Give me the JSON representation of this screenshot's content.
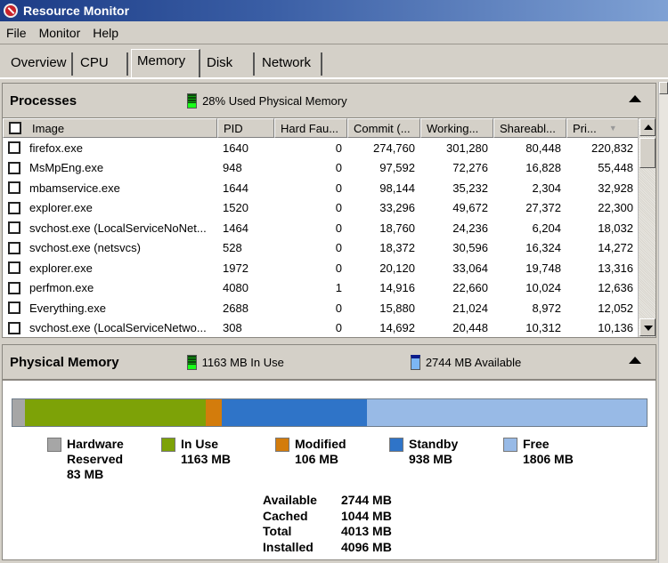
{
  "window": {
    "title": "Resource Monitor",
    "icon": "resource-monitor-icon"
  },
  "menu": [
    "File",
    "Monitor",
    "Help"
  ],
  "tabs": [
    {
      "label": "Overview",
      "active": false
    },
    {
      "label": "CPU",
      "active": false
    },
    {
      "label": "Memory",
      "active": true
    },
    {
      "label": "Disk",
      "active": false
    },
    {
      "label": "Network",
      "active": false
    }
  ],
  "processes": {
    "title": "Processes",
    "status": "28% Used Physical Memory",
    "columns": [
      "Image",
      "PID",
      "Hard Fau...",
      "Commit (...",
      "Working...",
      "Shareabl...",
      "Pri..."
    ],
    "sort_column": "Pri...",
    "rows": [
      {
        "image": "firefox.exe",
        "pid": "1640",
        "hard_faults": "0",
        "commit": "274,760",
        "working": "301,280",
        "shareable": "80,448",
        "private": "220,832"
      },
      {
        "image": "MsMpEng.exe",
        "pid": "948",
        "hard_faults": "0",
        "commit": "97,592",
        "working": "72,276",
        "shareable": "16,828",
        "private": "55,448"
      },
      {
        "image": "mbamservice.exe",
        "pid": "1644",
        "hard_faults": "0",
        "commit": "98,144",
        "working": "35,232",
        "shareable": "2,304",
        "private": "32,928"
      },
      {
        "image": "explorer.exe",
        "pid": "1520",
        "hard_faults": "0",
        "commit": "33,296",
        "working": "49,672",
        "shareable": "27,372",
        "private": "22,300"
      },
      {
        "image": "svchost.exe (LocalServiceNoNet...",
        "pid": "1464",
        "hard_faults": "0",
        "commit": "18,760",
        "working": "24,236",
        "shareable": "6,204",
        "private": "18,032"
      },
      {
        "image": "svchost.exe (netsvcs)",
        "pid": "528",
        "hard_faults": "0",
        "commit": "18,372",
        "working": "30,596",
        "shareable": "16,324",
        "private": "14,272"
      },
      {
        "image": "explorer.exe",
        "pid": "1972",
        "hard_faults": "0",
        "commit": "20,120",
        "working": "33,064",
        "shareable": "19,748",
        "private": "13,316"
      },
      {
        "image": "perfmon.exe",
        "pid": "4080",
        "hard_faults": "1",
        "commit": "14,916",
        "working": "22,660",
        "shareable": "10,024",
        "private": "12,636"
      },
      {
        "image": "Everything.exe",
        "pid": "2688",
        "hard_faults": "0",
        "commit": "15,880",
        "working": "21,024",
        "shareable": "8,972",
        "private": "12,052"
      },
      {
        "image": "svchost.exe (LocalServiceNetwo...",
        "pid": "308",
        "hard_faults": "0",
        "commit": "14,692",
        "working": "20,448",
        "shareable": "10,312",
        "private": "10,136"
      }
    ]
  },
  "physical_memory": {
    "title": "Physical Memory",
    "in_use_text": "1163 MB In Use",
    "available_text": "2744 MB Available",
    "segments": [
      {
        "name": "Hardware Reserved",
        "label_lines": [
          "Hardware",
          "Reserved",
          "83 MB"
        ],
        "mb": 83,
        "color": "#a6a6a6"
      },
      {
        "name": "In Use",
        "label_lines": [
          "In Use",
          "1163 MB"
        ],
        "mb": 1163,
        "color": "#7da207"
      },
      {
        "name": "Modified",
        "label_lines": [
          "Modified",
          "106 MB"
        ],
        "mb": 106,
        "color": "#d37c0c"
      },
      {
        "name": "Standby",
        "label_lines": [
          "Standby",
          "938 MB"
        ],
        "mb": 938,
        "color": "#2f74c8"
      },
      {
        "name": "Free",
        "label_lines": [
          "Free",
          "1806 MB"
        ],
        "mb": 1806,
        "color": "#98bae6"
      }
    ],
    "summary": [
      {
        "label": "Available",
        "value": "2744 MB"
      },
      {
        "label": "Cached",
        "value": "1044 MB"
      },
      {
        "label": "Total",
        "value": "4013 MB"
      },
      {
        "label": "Installed",
        "value": "4096 MB"
      }
    ]
  }
}
